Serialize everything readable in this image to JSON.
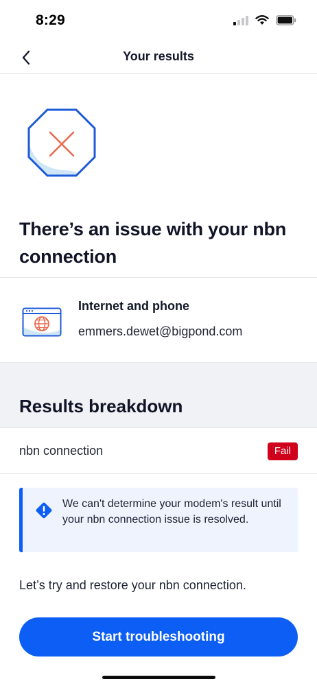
{
  "status_bar": {
    "time": "8:29",
    "icons": [
      "cellular-signal-icon",
      "wifi-icon",
      "battery-icon"
    ]
  },
  "nav": {
    "title": "Your results",
    "back_icon": "chevron-left-icon"
  },
  "hero": {
    "icon": "error-octagon-icon",
    "headline": "There’s an issue with your nbn connection"
  },
  "service": {
    "icon": "internet-browser-globe-icon",
    "title": "Internet and phone",
    "email": "emmers.dewet@bigpond.com"
  },
  "breakdown": {
    "title": "Results breakdown",
    "rows": [
      {
        "label": "nbn connection",
        "status": "Fail"
      }
    ]
  },
  "info_notice": {
    "icon": "warning-diamond-icon",
    "text": "We can't determine your modem's result until your nbn connection issue is resolved."
  },
  "restore_text": "Let’s try and restore your nbn connection.",
  "cta": {
    "label": "Start troubleshooting"
  },
  "colors": {
    "primary": "#0d5ef4",
    "fail": "#d0021b",
    "info_bg": "#eef3fd",
    "band_bg": "#f1f2f5"
  }
}
